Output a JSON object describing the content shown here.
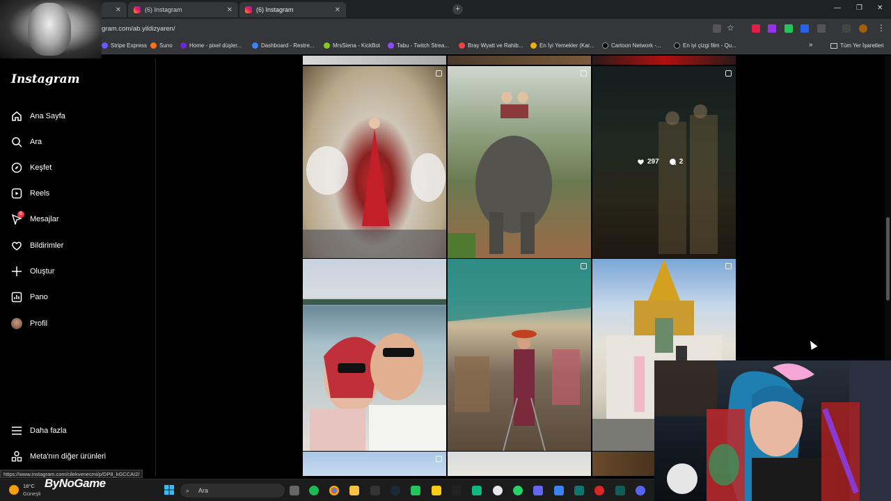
{
  "browser": {
    "tabs": [
      {
        "label": ""
      },
      {
        "label": "(6) Instagram"
      },
      {
        "label": "(6) Instagram"
      }
    ],
    "address": "gram.com/ab.yildizyaren/",
    "bookmarks": [
      {
        "label": "Stripe Express",
        "color": "#635bff"
      },
      {
        "label": "Suno",
        "color": "#f97316"
      },
      {
        "label": "Home - pixel düşler...",
        "color": "#6d28d9"
      },
      {
        "label": "Dashboard - Restre...",
        "color": "#3b82f6"
      },
      {
        "label": "MrsSiena - KickBot",
        "color": "#84cc16"
      },
      {
        "label": "Tabu - Twitch Strea...",
        "color": "#9146ff"
      },
      {
        "label": "Bray Wyatt ve Rahib...",
        "color": "#ef4444"
      },
      {
        "label": "En İyi Yemekler (Kar...",
        "color": "#eab308"
      },
      {
        "label": "Cartoon Network -...",
        "color": "#000000"
      },
      {
        "label": "En iyi çizgi film - Qu...",
        "color": "#111111"
      }
    ],
    "all_bookmarks": "Tüm Yer İşaretleri"
  },
  "sidebar": {
    "logo": "Instagram",
    "items": [
      {
        "label": "Ana Sayfa",
        "icon": "home-icon"
      },
      {
        "label": "Ara",
        "icon": "search-icon"
      },
      {
        "label": "Keşfet",
        "icon": "compass-icon"
      },
      {
        "label": "Reels",
        "icon": "reels-icon"
      },
      {
        "label": "Mesajlar",
        "icon": "messenger-icon",
        "badge": "6"
      },
      {
        "label": "Bildirimler",
        "icon": "heart-icon"
      },
      {
        "label": "Oluştur",
        "icon": "plus-icon"
      },
      {
        "label": "Pano",
        "icon": "dashboard-icon"
      },
      {
        "label": "Profil",
        "icon": "avatar"
      }
    ],
    "more": "Daha fazla",
    "meta": "Meta'nın diğer ürünleri"
  },
  "post_stats": {
    "likes": "297",
    "comments": "2"
  },
  "status_url": "https://www.instagram.com/cilekvenecmi/p/DP8_kGCCAI2/",
  "taskbar": {
    "weather_temp": "18°C",
    "weather_desc": "Güneşli",
    "watermark": "ByNoGame",
    "search_placeholder": "Ara"
  }
}
